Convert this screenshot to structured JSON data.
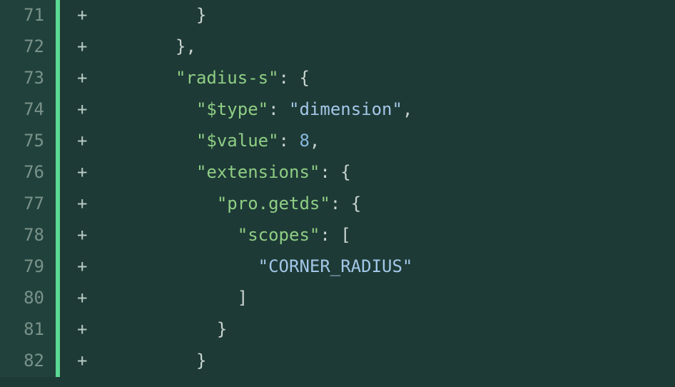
{
  "lines": [
    {
      "number": "71",
      "marker": "+",
      "tokens": [
        {
          "text": "          ",
          "class": ""
        },
        {
          "text": "}",
          "class": "tok-punct"
        }
      ]
    },
    {
      "number": "72",
      "marker": "+",
      "tokens": [
        {
          "text": "        ",
          "class": ""
        },
        {
          "text": "},",
          "class": "tok-punct"
        }
      ]
    },
    {
      "number": "73",
      "marker": "+",
      "tokens": [
        {
          "text": "        ",
          "class": ""
        },
        {
          "text": "\"radius-s\"",
          "class": "tok-key"
        },
        {
          "text": ": {",
          "class": "tok-punct"
        }
      ]
    },
    {
      "number": "74",
      "marker": "+",
      "tokens": [
        {
          "text": "          ",
          "class": ""
        },
        {
          "text": "\"$type\"",
          "class": "tok-key"
        },
        {
          "text": ": ",
          "class": "tok-punct"
        },
        {
          "text": "\"dimension\"",
          "class": "tok-string"
        },
        {
          "text": ",",
          "class": "tok-punct"
        }
      ]
    },
    {
      "number": "75",
      "marker": "+",
      "tokens": [
        {
          "text": "          ",
          "class": ""
        },
        {
          "text": "\"$value\"",
          "class": "tok-key"
        },
        {
          "text": ": ",
          "class": "tok-punct"
        },
        {
          "text": "8",
          "class": "tok-number"
        },
        {
          "text": ",",
          "class": "tok-punct"
        }
      ]
    },
    {
      "number": "76",
      "marker": "+",
      "tokens": [
        {
          "text": "          ",
          "class": ""
        },
        {
          "text": "\"extensions\"",
          "class": "tok-key"
        },
        {
          "text": ": {",
          "class": "tok-punct"
        }
      ]
    },
    {
      "number": "77",
      "marker": "+",
      "tokens": [
        {
          "text": "            ",
          "class": ""
        },
        {
          "text": "\"pro.getds\"",
          "class": "tok-key"
        },
        {
          "text": ": {",
          "class": "tok-punct"
        }
      ]
    },
    {
      "number": "78",
      "marker": "+",
      "tokens": [
        {
          "text": "              ",
          "class": ""
        },
        {
          "text": "\"scopes\"",
          "class": "tok-key"
        },
        {
          "text": ": [",
          "class": "tok-punct"
        }
      ]
    },
    {
      "number": "79",
      "marker": "+",
      "tokens": [
        {
          "text": "                ",
          "class": ""
        },
        {
          "text": "\"CORNER_RADIUS\"",
          "class": "tok-string"
        }
      ]
    },
    {
      "number": "80",
      "marker": "+",
      "tokens": [
        {
          "text": "              ",
          "class": ""
        },
        {
          "text": "]",
          "class": "tok-punct"
        }
      ]
    },
    {
      "number": "81",
      "marker": "+",
      "tokens": [
        {
          "text": "            ",
          "class": ""
        },
        {
          "text": "}",
          "class": "tok-punct"
        }
      ]
    },
    {
      "number": "82",
      "marker": "+",
      "tokens": [
        {
          "text": "          ",
          "class": ""
        },
        {
          "text": "}",
          "class": "tok-punct"
        }
      ]
    }
  ]
}
